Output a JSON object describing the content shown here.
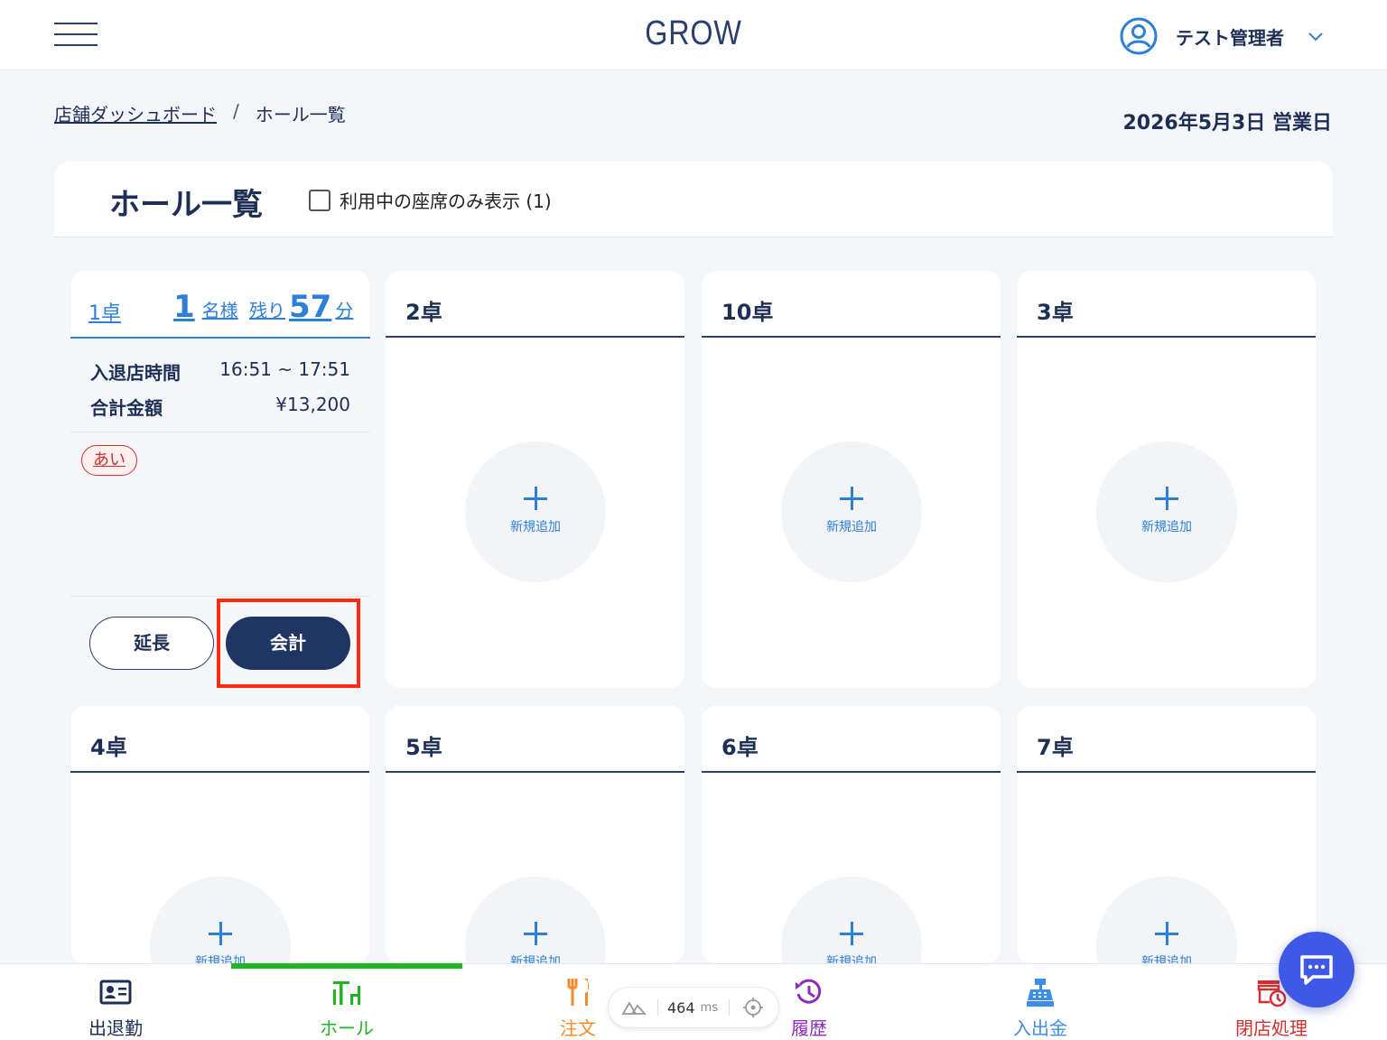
{
  "header": {
    "logo": "GROW",
    "user_name": "テスト管理者"
  },
  "breadcrumb": {
    "parent": "店舗ダッシュボード",
    "separator": "/",
    "current": "ホール一覧"
  },
  "business_date": "2026年5月3日 営業日",
  "panel": {
    "title": "ホール一覧",
    "filter_label": "利用中の座席のみ表示 (1)",
    "filter_checked": false
  },
  "active_table": {
    "name": "1卓",
    "guests": "1",
    "guests_unit": "名様",
    "remaining_prefix": "残り",
    "remaining": "57",
    "remaining_unit": "分",
    "time_label": "入退店時間",
    "time_value": "16:51 ~ 17:51",
    "total_label": "合計金額",
    "total_value": "¥13,200",
    "tag": "あい",
    "extend_label": "延長",
    "checkout_label": "会計"
  },
  "add_label": "新規追加",
  "tables": [
    {
      "name": "2卓"
    },
    {
      "name": "10卓"
    },
    {
      "name": "3卓"
    },
    {
      "name": "4卓"
    },
    {
      "name": "5卓"
    },
    {
      "name": "6卓"
    },
    {
      "name": "7卓"
    }
  ],
  "bottom_nav": [
    {
      "label": "出退勤",
      "icon": "id-card-icon",
      "color": "#1e2f55"
    },
    {
      "label": "ホール",
      "icon": "table-chairs-icon",
      "color": "#22b422"
    },
    {
      "label": "注文",
      "icon": "fork-knife-icon",
      "color": "#f28c28"
    },
    {
      "label": "履歴",
      "icon": "history-icon",
      "color": "#8e2bb8"
    },
    {
      "label": "入出金",
      "icon": "cash-register-icon",
      "color": "#3d8ee6"
    },
    {
      "label": "閉店処理",
      "icon": "store-close-icon",
      "color": "#d32f2f"
    }
  ],
  "perf": {
    "value": "464",
    "unit": "ms"
  }
}
